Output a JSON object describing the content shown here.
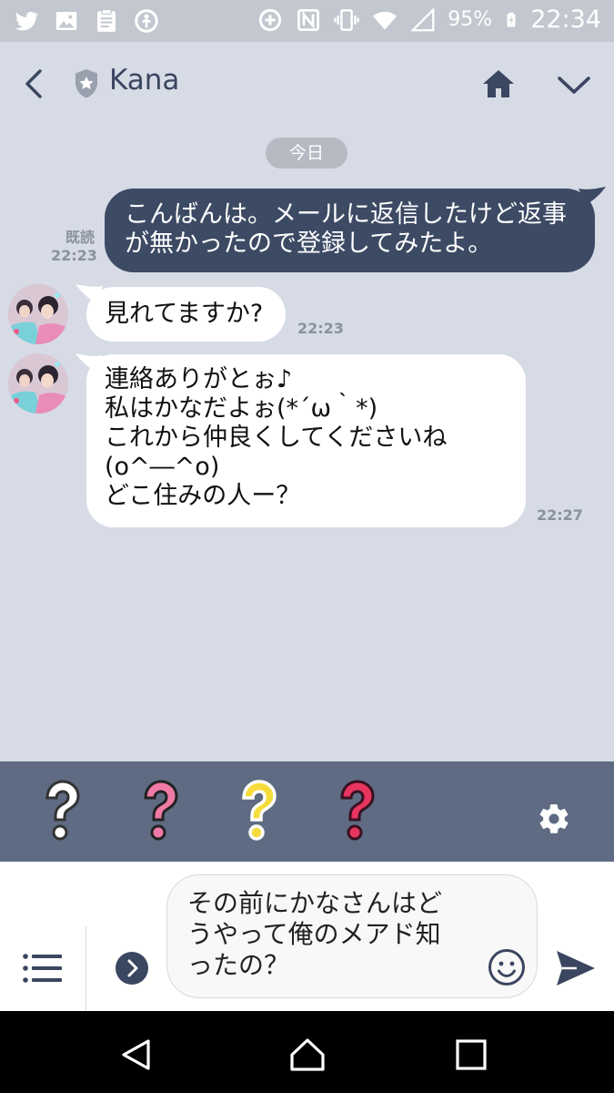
{
  "status_bar": {
    "battery": "95%",
    "time": "22:34",
    "left_icons": [
      "twitter-icon",
      "image-icon",
      "clipboard-icon",
      "accessibility-icon"
    ],
    "right_icons": [
      "data-saver-icon",
      "nfc-icon",
      "vibrate-icon",
      "wifi-icon",
      "signal-icon",
      "battery-icon"
    ]
  },
  "header": {
    "contact_name": "Kana"
  },
  "chat": {
    "date_label": "今日",
    "messages": [
      {
        "direction": "sent",
        "text": "こんばんは。メールに返信したけど返事が無かったので登録してみたよ。",
        "status": "既読",
        "time": "22:23"
      },
      {
        "direction": "received",
        "text": "見れてますか?",
        "time": "22:23"
      },
      {
        "direction": "received",
        "lines": [
          "連絡ありがとぉ♪",
          "私はかなだよぉ(*´ω｀*)",
          "これから仲良くしてくださいね",
          "(o^―^o)",
          "どこ住みの人ー？"
        ],
        "time": "22:27"
      }
    ]
  },
  "stickers": {
    "items": [
      {
        "name": "question-white",
        "color": "#ffffff"
      },
      {
        "name": "question-pink",
        "color": "#f07aa6"
      },
      {
        "name": "question-yellow",
        "color": "#f6dc3b"
      },
      {
        "name": "question-red",
        "color": "#e7355f"
      }
    ]
  },
  "composer": {
    "input_value": "その前にかなさんはどうやって俺のメアド知ったの？"
  },
  "colors": {
    "background": "#d6dbe6",
    "sent_bubble": "#3c4a64",
    "sticker_bar": "#5e6b82",
    "header_icon": "#3b4660"
  }
}
